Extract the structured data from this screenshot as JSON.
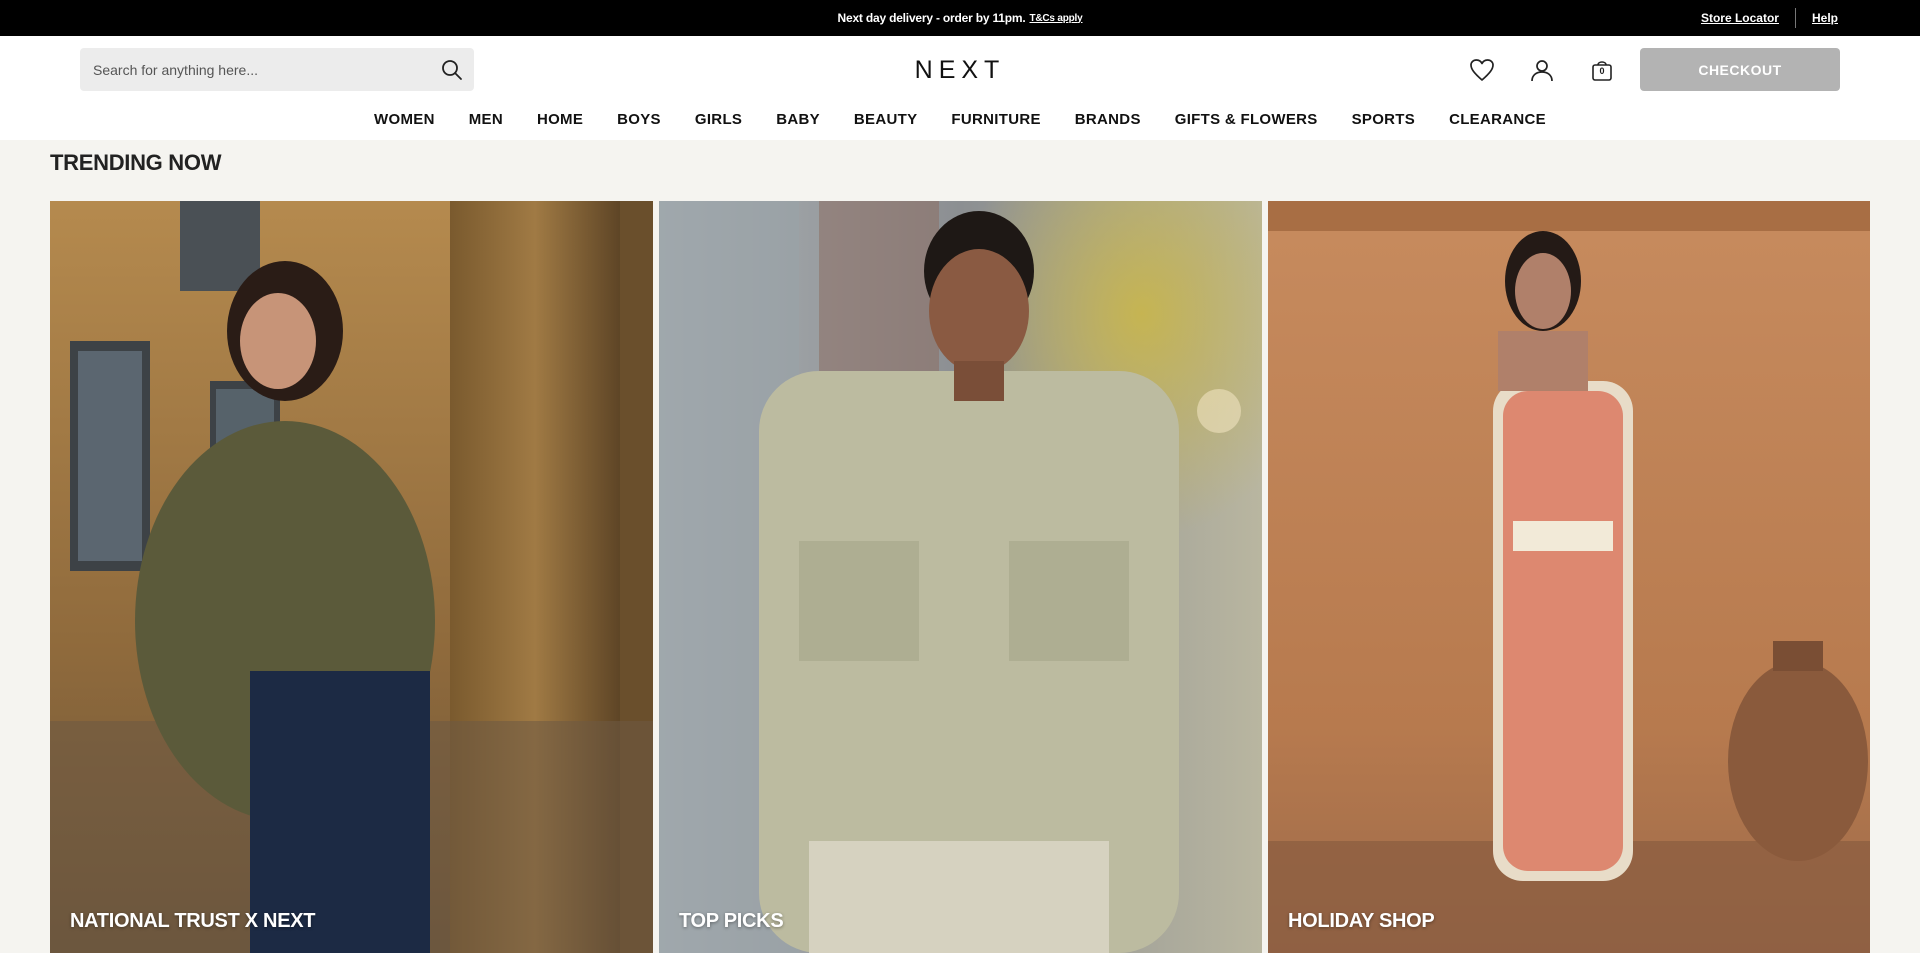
{
  "promo": {
    "message": "Next day delivery - order by 11pm.",
    "terms_link": "T&Cs apply",
    "store_locator": "Store Locator",
    "help": "Help"
  },
  "header": {
    "search_placeholder": "Search for anything here...",
    "logo": "NEXT",
    "bag_count": "0",
    "checkout_label": "CHECKOUT",
    "icons": [
      "search-icon",
      "heart-icon",
      "account-icon",
      "bag-icon"
    ]
  },
  "nav": {
    "items": [
      "WOMEN",
      "MEN",
      "HOME",
      "BOYS",
      "GIRLS",
      "BABY",
      "BEAUTY",
      "FURNITURE",
      "BRANDS",
      "GIFTS & FLOWERS",
      "SPORTS",
      "CLEARANCE"
    ]
  },
  "trending": {
    "title": "TRENDING NOW",
    "tiles": [
      {
        "label": "NATIONAL TRUST X NEXT"
      },
      {
        "label": "TOP PICKS"
      },
      {
        "label": "HOLIDAY SHOP"
      }
    ]
  },
  "colors": {
    "promo_bg": "#000000",
    "page_bg": "#f5f4f0",
    "checkout_bg": "#b3b3b3"
  }
}
